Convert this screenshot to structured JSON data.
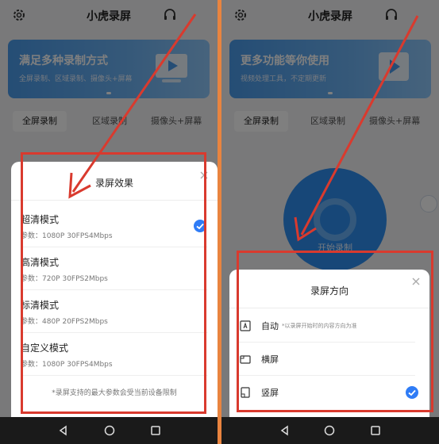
{
  "app": {
    "title": "小虎录屏"
  },
  "left": {
    "banner": {
      "title": "满足多种录制方式",
      "subtitle": "全屏录制、区域录制、摄像头+屏幕"
    },
    "tabs": [
      "全屏录制",
      "区域录制",
      "摄像头+屏幕"
    ],
    "sheet": {
      "title": "录屏效果",
      "options": [
        {
          "name": "超清模式",
          "param": "参数：1080P 30FPS4Mbps",
          "selected": true
        },
        {
          "name": "高清模式",
          "param": "参数：720P 30FPS2Mbps",
          "selected": false
        },
        {
          "name": "标清模式",
          "param": "参数：480P 20FPS2Mbps",
          "selected": false
        },
        {
          "name": "自定义模式",
          "param": "参数：1080P 30FPS4Mbps",
          "selected": false
        }
      ],
      "footnote": "*录屏支持的最大参数会受当前设备限制"
    }
  },
  "right": {
    "banner": {
      "title": "更多功能等你使用",
      "subtitle": "视频处理工具，不定期更新"
    },
    "tabs": [
      "全屏录制",
      "区域录制",
      "摄像头+屏幕"
    ],
    "disc_label": "开始录制",
    "sheet": {
      "title": "录屏方向",
      "options": [
        {
          "label": "自动",
          "hint": "*以录屏开始时的内容方向为准",
          "icon": "auto-rotate-icon",
          "selected": false
        },
        {
          "label": "横屏",
          "hint": "",
          "icon": "landscape-icon",
          "selected": false
        },
        {
          "label": "竖屏",
          "hint": "",
          "icon": "portrait-icon",
          "selected": true
        }
      ]
    }
  },
  "colors": {
    "accent": "#2f7cf6",
    "highlight": "#d93a2e",
    "frame": "#e9843f"
  }
}
